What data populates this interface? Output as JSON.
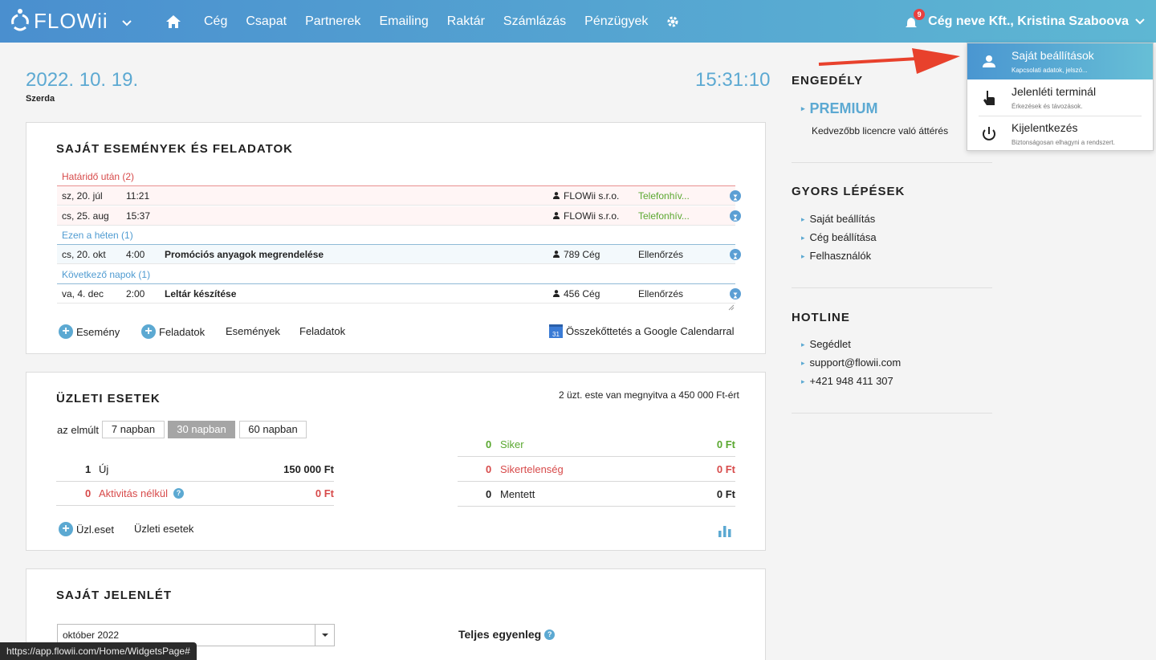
{
  "nav": {
    "logo": "FLOWii",
    "items": [
      "Cég",
      "Csapat",
      "Partnerek",
      "Emailing",
      "Raktár",
      "Számlázás",
      "Pénzügyek"
    ],
    "notifications": "9",
    "user": "Cég neve Kft., Kristina Szaboova"
  },
  "header": {
    "date": "2022. 10. 19.",
    "weekday": "Szerda",
    "time": "15:31:10"
  },
  "events": {
    "title": "SAJÁT ESEMÉNYEK ÉS FELADATOK",
    "groups": [
      {
        "label": "Határidő után (2)",
        "rows": [
          {
            "date": "sz, 20. júl",
            "time": "11:21",
            "title": "",
            "company": "FLOWii s.r.o.",
            "type": "Telefonhív..."
          },
          {
            "date": "cs, 25. aug",
            "time": "15:37",
            "title": "",
            "company": "FLOWii s.r.o.",
            "type": "Telefonhív..."
          }
        ]
      },
      {
        "label": "Ezen a héten (1)",
        "rows": [
          {
            "date": "cs, 20. okt",
            "time": "4:00",
            "title": "Promóciós anyagok megrendelése",
            "company": "789 Cég",
            "type": "Ellenőrzés"
          }
        ]
      },
      {
        "label": "Következő napok (1)",
        "rows": [
          {
            "date": "va, 4. dec",
            "time": "2:00",
            "title": "Leltár készítése",
            "company": "456 Cég",
            "type": "Ellenőrzés"
          }
        ]
      }
    ],
    "links": {
      "add_event": "Esemény",
      "add_task": "Feladatok",
      "events": "Események",
      "tasks": "Feladatok",
      "gcal": "Összekőttetés a Google Calendarral",
      "gcal_icon": "31"
    }
  },
  "business": {
    "title": "ÜZLETI ESETEK",
    "summary": "2 üzt. este van megnyitva a 450 000 Ft-ért",
    "period_label": "az elmúlt",
    "periods": [
      "7 napban",
      "30 napban",
      "60 napban"
    ],
    "left": [
      {
        "count": "1",
        "label": "Új",
        "amount": "150 000 Ft"
      },
      {
        "count": "0",
        "label": "Aktivitás nélkül",
        "amount": "0 Ft"
      }
    ],
    "right": [
      {
        "count": "0",
        "label": "Siker",
        "amount": "0 Ft"
      },
      {
        "count": "0",
        "label": "Sikertelenség",
        "amount": "0 Ft"
      },
      {
        "count": "0",
        "label": "Mentett",
        "amount": "0 Ft"
      }
    ],
    "links": {
      "add_case": "Üzl.eset",
      "cases": "Üzleti esetek"
    }
  },
  "attendance": {
    "title": "SAJÁT JELENLÉT",
    "month": "október 2022",
    "balance_label": "Teljes egyenleg"
  },
  "sidebar": {
    "license_title": "ENGEDÉLY",
    "premium": "PREMIUM",
    "premium_desc": "Kedvezőbb licencre való áttérés",
    "quick_title": "GYORS LÉPÉSEK",
    "quick": [
      "Saját beállítás",
      "Cég beállítása",
      "Felhasználók"
    ],
    "hotline_title": "HOTLINE",
    "hotline": [
      "Segédlet",
      "support@flowii.com",
      "+421 948 411 307"
    ]
  },
  "dropdown": [
    {
      "label": "Saját beállítások",
      "sub": "Kapcsolati adatok, jelszó..."
    },
    {
      "label": "Jelenléti terminál",
      "sub": "Érkezések és távozások."
    },
    {
      "label": "Kijelentkezés",
      "sub": "Biztonságosan elhagyni a rendszert."
    }
  ],
  "statusbar": "https://app.flowii.com/Home/WidgetsPage#",
  "colors": {
    "accent": "#5ca9d2",
    "red": "#d74a4a",
    "green": "#5aa830",
    "arrow": "#e8412c"
  }
}
